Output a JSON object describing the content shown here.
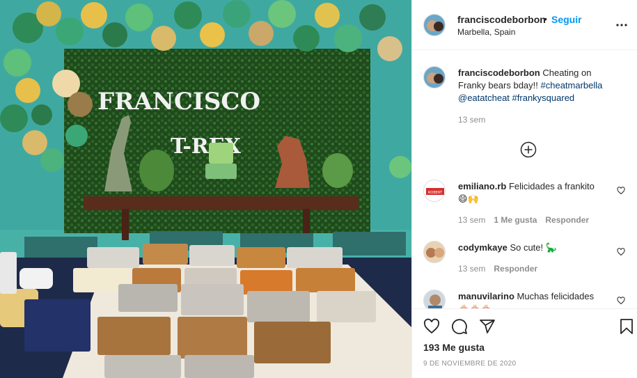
{
  "post": {
    "username": "franciscodeborbon",
    "follow_label": "Seguir",
    "follow_separator": "•",
    "location": "Marbella, Spain",
    "photo_banner": "FRANCISCO",
    "photo_banner2": "T-REX",
    "caption": {
      "username": "franciscodeborbon",
      "text": " Cheating on Franky bears bday!! ",
      "tags": [
        "#cheatmarbella",
        "@eatatcheat",
        "#frankysquared"
      ],
      "time": "13 sem"
    },
    "comments": [
      {
        "username": "emiliano.rb",
        "text": " Felicidades a frankito",
        "emoji": "😄🙌",
        "time": "13 sem",
        "likes": "1 Me gusta",
        "reply": "Responder",
        "avatar_text": "ROBERT"
      },
      {
        "username": "codymkaye",
        "text": " So cute! ",
        "emoji": "🦕",
        "time": "13 sem",
        "reply": "Responder"
      },
      {
        "username": "manuvilarino",
        "text": " Muchas felicidades",
        "emoji": "🎂🎂🎂"
      }
    ],
    "likes_count": "193 Me gusta",
    "date": "9 DE NOVIEMBRE DE 2020"
  },
  "colors": {
    "accent": "#0095f6",
    "link": "#00376b",
    "muted": "#8e8e8e",
    "text": "#262626"
  },
  "icons": {
    "more": "more-options-icon",
    "load_more": "plus-circle-icon",
    "like": "heart-icon",
    "comment": "comment-icon",
    "share": "share-icon",
    "save": "bookmark-icon"
  }
}
